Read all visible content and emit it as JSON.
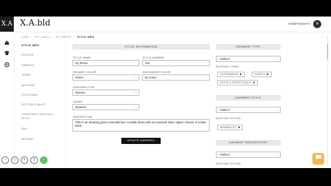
{
  "header": {
    "logo_mark": "X.A",
    "brand": "X.A.bld",
    "brand_caret": "⌃",
    "user_name": "NINETEENTH"
  },
  "rail_icons": [
    "home-icon",
    "shirt-icon",
    "settings-icon"
  ],
  "breadcrumb": {
    "items": [
      "LOBS",
      "IVY LABEL",
      "IVY DRESS"
    ],
    "current": "STYLE INFO",
    "separator": "›"
  },
  "sidenav": {
    "items": [
      "STYLE INFO",
      "PHOTOS",
      "FABRICS",
      "TRIMS",
      "NOTIONS",
      "STITCHING",
      "CUTTER'S MUST",
      "CONSTRUCTION CALL OUTS",
      "SKU",
      "REVIEW"
    ],
    "active": "STYLE INFO"
  },
  "style_info": {
    "header": "STYLE INFORMATION",
    "style_name_label": "STYLE NAME",
    "style_name_value": "Ivy Dress",
    "style_number_label": "STYLE NUMBER",
    "style_number_value": "101",
    "primary_color_label": "PRIMARY COLOR",
    "primary_color_value": "Green",
    "secondary_color_label": "SECONDARY COLOR",
    "secondary_color_value": "No Color",
    "designed_for_label": "DESIGNED FOR",
    "designed_for_value": "Women",
    "sizing_label": "SIZING",
    "sizing_value": "Numeric",
    "description_label": "DESCRIPTION",
    "description_value": "This is an amazing green emerald lace cocktail dress with an exposed silver zipper closure in center back.",
    "update_button": "UPDATE GARMENT",
    "select_arrow": "⌃⌄"
  },
  "garment_type": {
    "header": "GARMENT TYPE",
    "select_value": "--Select--",
    "existing_label": "EXISTING TYPES",
    "tags": [
      "OUTERWEAR",
      "SHIRTS",
      "SUITS & SPORTCOATS"
    ],
    "remove_glyph": "✖"
  },
  "garment_style": {
    "header": "GARMENT STYLE",
    "select_value": "--Select--",
    "existing_label": "EXISTING STYLES",
    "tags": [
      "MINIMALIST"
    ]
  },
  "garment_descriptors": {
    "header": "GARMENT DESCRIPTORS",
    "select_value": "--Select--",
    "existing_label": "EXISTING STYLES"
  },
  "toolbar": {
    "buttons": [
      "−",
      "▭",
      "✕",
      "∥",
      "✓"
    ]
  },
  "chat": {
    "glyph": "💬"
  },
  "colors": {
    "chat_accent": "#f3b74f",
    "toolbar_accept": "#5cc55c",
    "button_dark": "#111111"
  }
}
